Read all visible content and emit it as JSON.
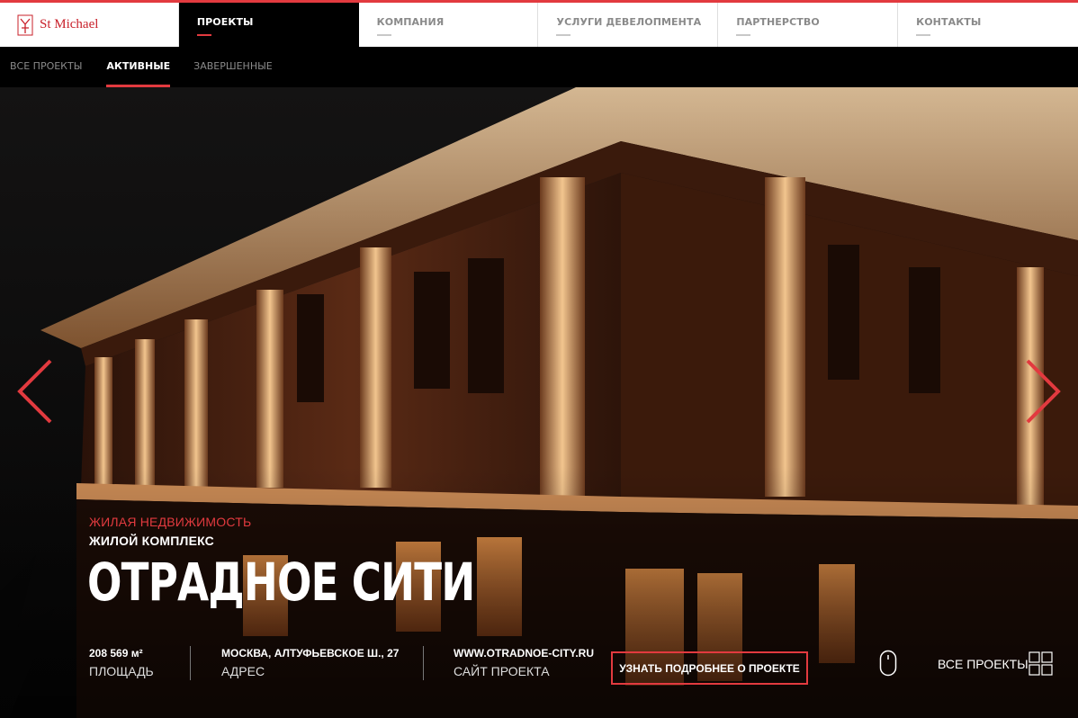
{
  "brand": {
    "name": "St Michael",
    "accent": "#e23a3f"
  },
  "nav": {
    "items": [
      {
        "label": "ПРОЕКТЫ",
        "active": true
      },
      {
        "label": "КОМПАНИЯ",
        "active": false
      },
      {
        "label": "УСЛУГИ ДЕВЕЛОПМЕНТА",
        "active": false
      },
      {
        "label": "ПАРТНЕРСТВО",
        "active": false
      },
      {
        "label": "КОНТАКТЫ",
        "active": false
      }
    ]
  },
  "subnav": {
    "items": [
      {
        "label": "ВСЕ ПРОЕКТЫ",
        "active": false
      },
      {
        "label": "АКТИВНЫЕ",
        "active": true
      },
      {
        "label": "ЗАВЕРШЕННЫЕ",
        "active": false
      }
    ]
  },
  "hero": {
    "category": "ЖИЛАЯ НЕДВИЖИМОСТЬ",
    "kind": "ЖИЛОЙ КОМПЛЕКС",
    "title": "ОТРАДНОЕ СИТИ",
    "facts": [
      {
        "value": "208 569 м²",
        "caption": "ПЛОЩАДЬ"
      },
      {
        "value": "МОСКВА, АЛТУФЬЕВСКОЕ Ш., 27",
        "caption": "АДРЕС"
      },
      {
        "value": "WWW.OTRADNOE-CITY.RU",
        "caption": "САЙТ ПРОЕКТА"
      }
    ],
    "more_button": "УЗНАТЬ ПОДРОБНЕЕ О ПРОЕКТЕ",
    "all_projects": "ВСЕ ПРОЕКТЫ"
  }
}
